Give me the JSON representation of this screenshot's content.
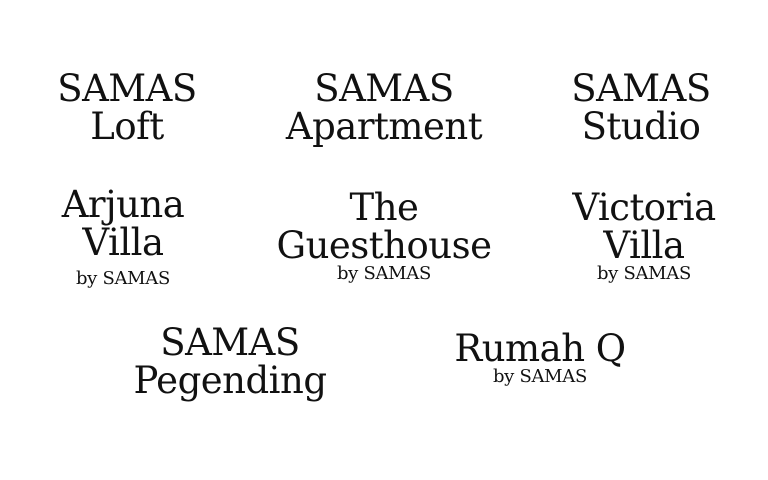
{
  "logos": [
    {
      "lines": [
        "SAMAS",
        "Loft"
      ],
      "sub": ""
    },
    {
      "lines": [
        "SAMAS",
        "Apartment"
      ],
      "sub": ""
    },
    {
      "lines": [
        "SAMAS",
        "Studio"
      ],
      "sub": ""
    },
    {
      "lines": [
        "Arjuna",
        "Villa"
      ],
      "sub": "by SAMAS"
    },
    {
      "lines": [
        "The",
        "Guesthouse"
      ],
      "sub": "by SAMAS"
    },
    {
      "lines": [
        "Victoria",
        "Villa"
      ],
      "sub": "by SAMAS"
    },
    {
      "lines": [
        "SAMAS",
        "Pegending"
      ],
      "sub": ""
    },
    {
      "lines": [
        "Rumah Q"
      ],
      "sub": "by SAMAS"
    }
  ],
  "colors": {
    "text": "#111111",
    "background": "#ffffff"
  }
}
